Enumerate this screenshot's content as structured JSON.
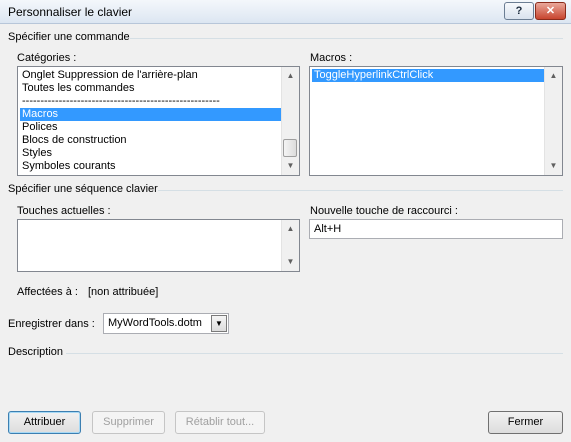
{
  "window": {
    "title": "Personnaliser le clavier",
    "help_label": "?",
    "close_label": "✕"
  },
  "section_command": {
    "label": "Spécifier une commande"
  },
  "categories": {
    "label": "Catégories :",
    "items": [
      "Onglet Suppression de l'arrière-plan",
      "Toutes les commandes",
      "------------------------------------------------------",
      "Macros",
      "Polices",
      "Blocs de construction",
      "Styles",
      "Symboles courants"
    ],
    "selected": "Macros"
  },
  "macros": {
    "label": "Macros :",
    "items": [
      "ToggleHyperlinkCtrlClick"
    ],
    "selected": "ToggleHyperlinkCtrlClick"
  },
  "section_keys": {
    "label": "Spécifier une séquence clavier"
  },
  "current_keys": {
    "label": "Touches actuelles :"
  },
  "new_shortcut": {
    "label": "Nouvelle touche de raccourci :",
    "value": "Alt+H"
  },
  "assigned": {
    "label": "Affectées à :",
    "value": "[non attribuée]"
  },
  "save_in": {
    "label": "Enregistrer dans :",
    "value": "MyWordTools.dotm"
  },
  "description": {
    "label": "Description"
  },
  "buttons": {
    "assign": "Attribuer",
    "remove": "Supprimer",
    "reset": "Rétablir tout...",
    "close": "Fermer"
  },
  "icons": {
    "scroll_up": "▲",
    "scroll_down": "▼",
    "dropdown": "▼"
  }
}
